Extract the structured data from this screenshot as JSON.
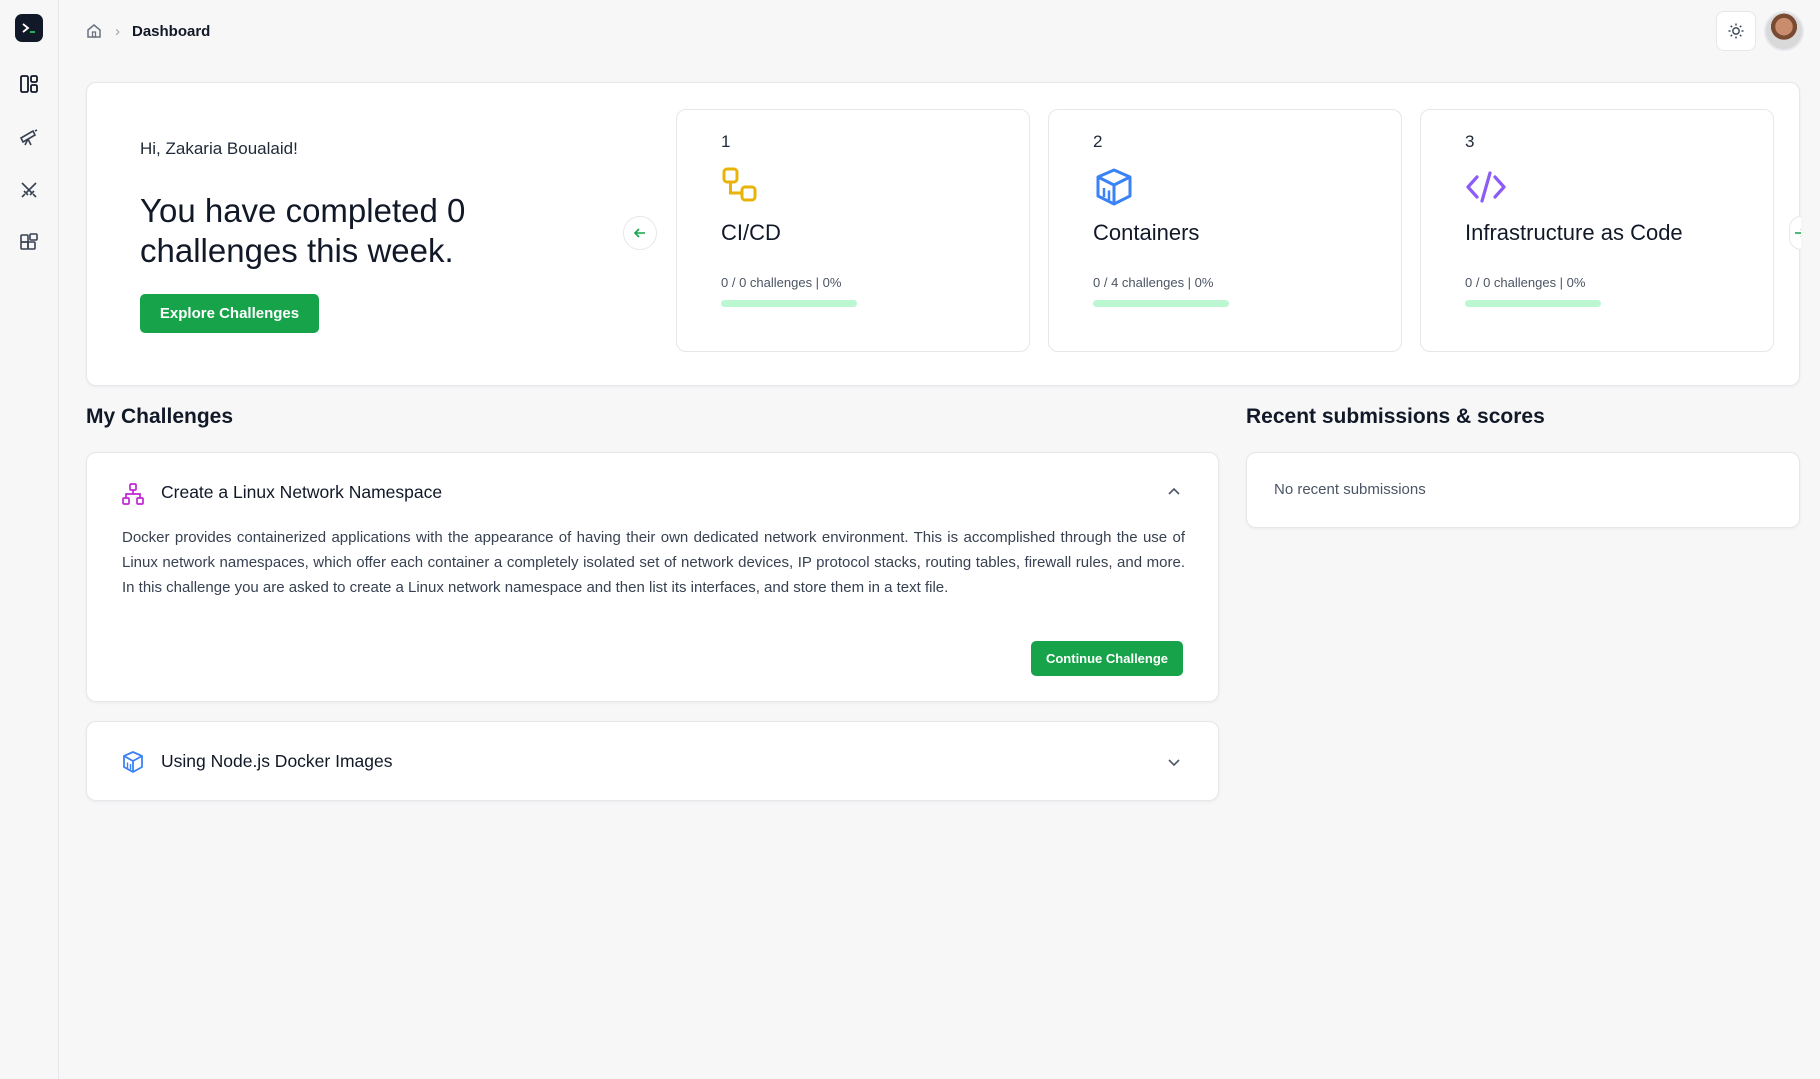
{
  "breadcrumb": {
    "current": "Dashboard"
  },
  "hero": {
    "greeting": "Hi, Zakaria Boualaid!",
    "headline": "You have completed 0 challenges this week.",
    "explore_label": "Explore Challenges"
  },
  "categories": [
    {
      "number": "1",
      "title": "CI/CD",
      "progress_text": "0 / 0 challenges | 0%",
      "progress_fraction": 0,
      "icon": "cicd-icon",
      "color": "#eab308"
    },
    {
      "number": "2",
      "title": "Containers",
      "progress_text": "0 / 4 challenges | 0%",
      "progress_fraction": 0,
      "icon": "container-box-icon",
      "color": "#3b82f6"
    },
    {
      "number": "3",
      "title": "Infrastructure as Code",
      "progress_text": "0 / 0 challenges | 0%",
      "progress_fraction": 0,
      "icon": "code-icon",
      "color": "#8b5cf6"
    }
  ],
  "my_challenges": {
    "title": "My Challenges",
    "items": [
      {
        "title": "Create a Linux Network Namespace",
        "description": "Docker provides containerized applications with the appearance of having their own dedicated network environment. This is accomplished through the use of Linux network namespaces, which offer each container a completely isolated set of network devices, IP protocol stacks, routing tables, firewall rules, and more. In this challenge you are asked to create a Linux network namespace and then list its interfaces, and store them in a text file.",
        "action_label": "Continue Challenge",
        "expanded": true,
        "icon": "network-icon",
        "icon_color": "#c026d3"
      },
      {
        "title": "Using Node.js Docker Images",
        "expanded": false,
        "icon": "container-box-icon",
        "icon_color": "#3b82f6"
      }
    ]
  },
  "recent": {
    "title": "Recent submissions & scores",
    "empty_text": "No recent submissions"
  },
  "colors": {
    "accent": "#16a34a",
    "track": "#bbf7d0"
  }
}
